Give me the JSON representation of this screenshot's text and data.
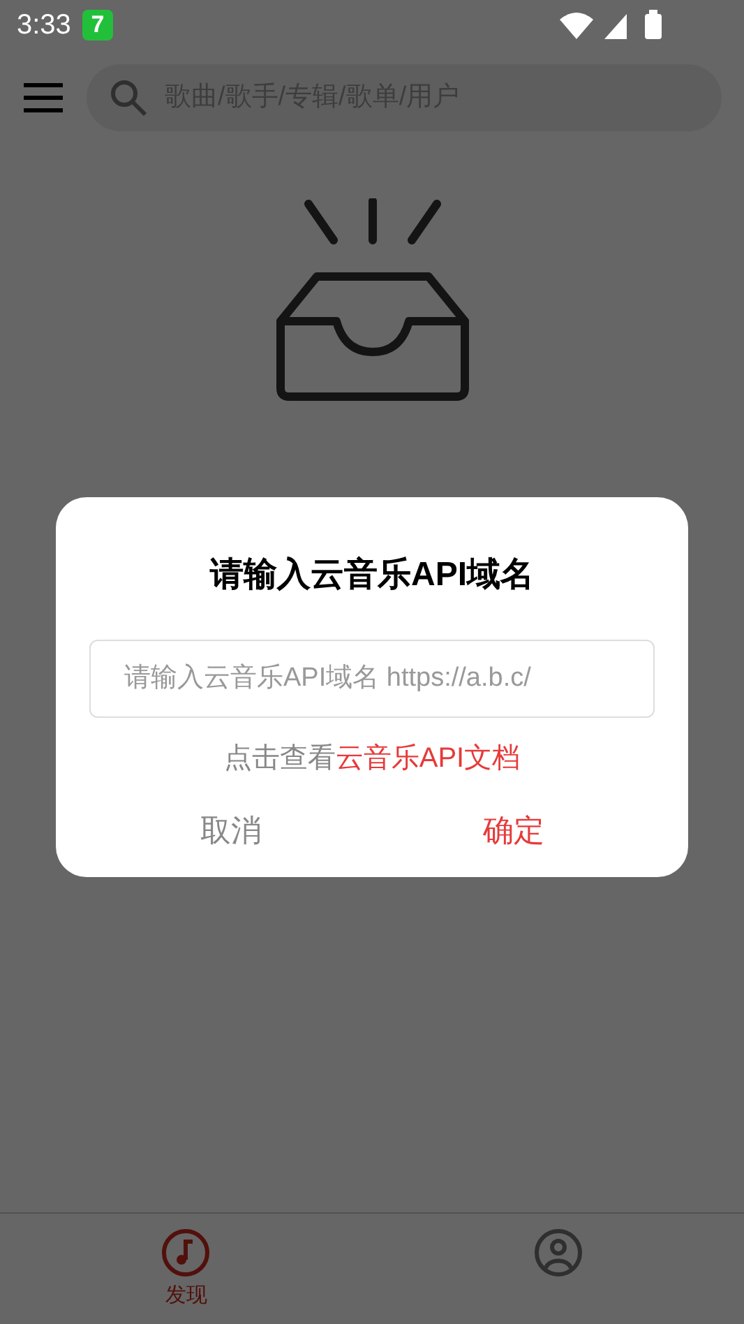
{
  "status_bar": {
    "time": "3:33",
    "notification_badge": "7"
  },
  "search": {
    "placeholder": "歌曲/歌手/专辑/歌单/用户"
  },
  "dialog": {
    "title": "请输入云音乐API域名",
    "input": {
      "placeholder": "请输入云音乐API域名 https://a.b.c/"
    },
    "hint_prefix": "点击查看",
    "hint_link": "云音乐API文档",
    "cancel": "取消",
    "confirm": "确定"
  },
  "tabs": [
    {
      "kind": "music",
      "label": "发现",
      "selected": true
    },
    {
      "kind": "user",
      "selected": false
    }
  ]
}
